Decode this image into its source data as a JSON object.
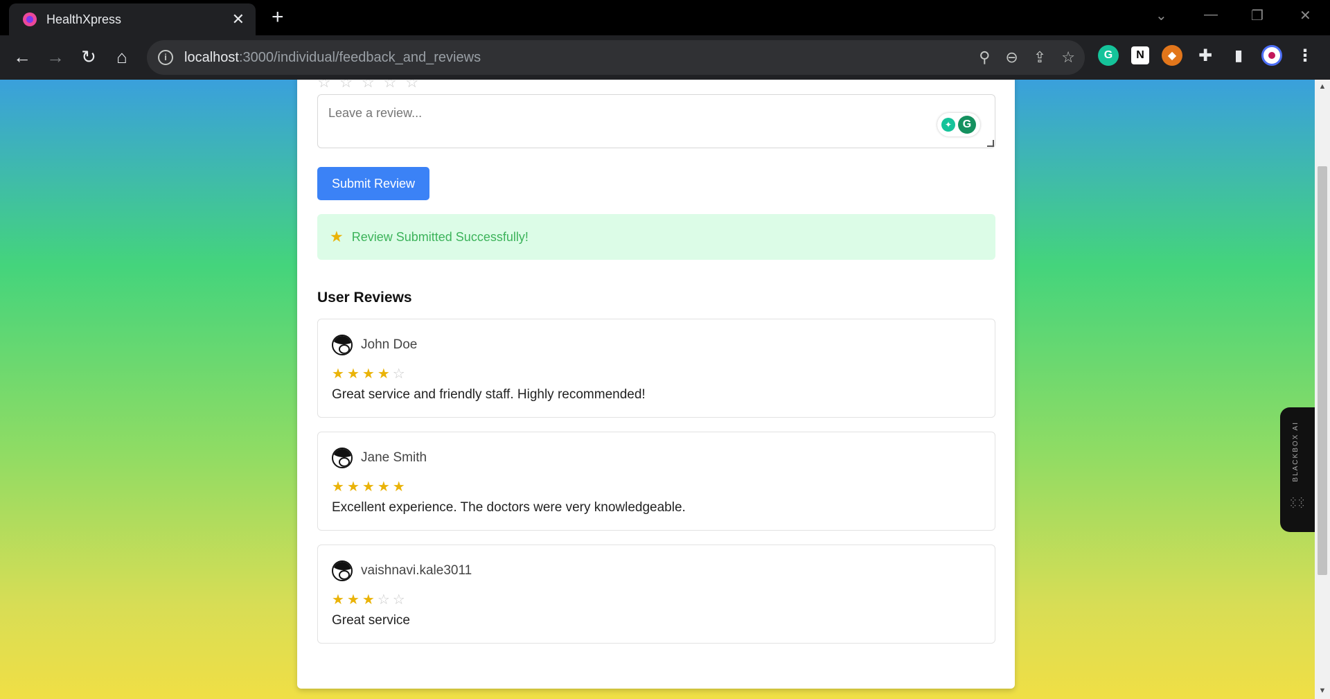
{
  "browser": {
    "tab_title": "HealthXpress",
    "url_host": "localhost",
    "url_path": ":3000/individual/feedback_and_reviews"
  },
  "form": {
    "review_placeholder": "Leave a review...",
    "submit_label": "Submit Review",
    "success_message": "Review Submitted Successfully!"
  },
  "reviews_section": {
    "title": "User Reviews",
    "items": [
      {
        "name": "John Doe",
        "rating": 4,
        "max_rating": 5,
        "comment": "Great service and friendly staff. Highly recommended!"
      },
      {
        "name": "Jane Smith",
        "rating": 5,
        "max_rating": 5,
        "comment": "Excellent experience. The doctors were very knowledgeable."
      },
      {
        "name": "vaishnavi.kale3011",
        "rating": 3,
        "max_rating": 5,
        "comment": "Great service"
      }
    ]
  },
  "sidebar_widget": {
    "label": "BLACKBOX AI"
  },
  "colors": {
    "primary": "#3b82f6",
    "star": "#eab308",
    "success_bg": "#dcfce7",
    "success_text": "#3cb35a"
  }
}
